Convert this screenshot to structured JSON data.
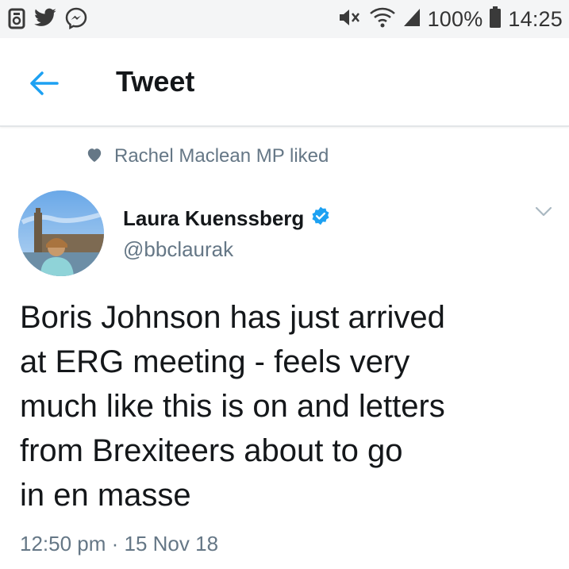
{
  "status_bar": {
    "battery": "100%",
    "time": "14:25",
    "left_icons": [
      "notification-icon",
      "twitter-icon",
      "messenger-icon"
    ],
    "right_icons": [
      "mute-icon",
      "wifi-icon",
      "signal-icon",
      "battery-icon"
    ]
  },
  "header": {
    "title": "Tweet",
    "back_icon": "back-arrow-icon"
  },
  "social_context": {
    "icon": "heart-icon",
    "text": "Rachel Maclean MP liked"
  },
  "author": {
    "name": "Laura Kuenssberg",
    "handle": "@bbclaurak",
    "verified": true
  },
  "tweet": {
    "lines": [
      "Boris Johnson has just arrived",
      "at ERG meeting - feels very",
      "much like this is on and letters",
      "from Brexiteers about to go",
      "in en masse"
    ],
    "timestamp": "12:50 pm · 15 Nov 18"
  },
  "colors": {
    "accent": "#1da1f2",
    "text_primary": "#14171a",
    "text_secondary": "#657786",
    "status_bar_bg": "#f4f5f6"
  }
}
